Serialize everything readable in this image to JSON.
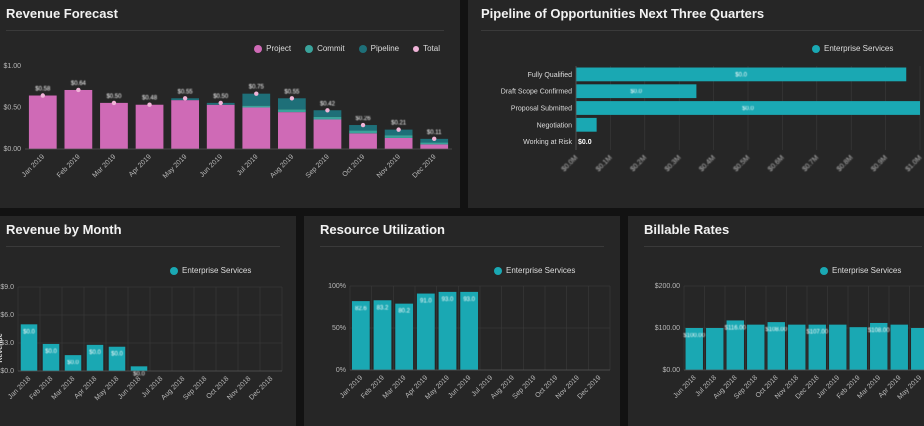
{
  "colors": {
    "project": "#cf6ab6",
    "commit": "#3aa39b",
    "pipeline": "#1e6f78",
    "total": "#f0b4d8",
    "enterprise": "#1aa8b3",
    "grid": "#3c3c3c",
    "text": "#b8b8b8"
  },
  "panels": {
    "revenue_forecast": {
      "title": "Revenue Forecast",
      "legend": [
        "Project",
        "Commit",
        "Pipeline",
        "Total"
      ]
    },
    "pipeline": {
      "title": "Pipeline of Opportunities Next Three Quarters",
      "legend": [
        "Enterprise Services"
      ]
    },
    "revenue_by_month": {
      "title": "Revenue by Month",
      "legend": [
        "Enterprise Services"
      ],
      "ylabel": "Revenue"
    },
    "resource_utilization": {
      "title": "Resource Utilization",
      "legend": [
        "Enterprise Services"
      ]
    },
    "billable_rates": {
      "title": "Billable Rates",
      "legend": [
        "Enterprise Services"
      ]
    }
  },
  "chart_data": [
    {
      "id": "revenue_forecast",
      "type": "bar",
      "stacked": true,
      "categories": [
        "Jan 2019",
        "Feb 2019",
        "Mar 2019",
        "Apr 2019",
        "May 2019",
        "Jun 2019",
        "Jul 2019",
        "Aug 2019",
        "Sep 2019",
        "Oct 2019",
        "Nov 2019",
        "Dec 2019"
      ],
      "series": [
        {
          "name": "Project",
          "values": [
            0.58,
            0.64,
            0.5,
            0.48,
            0.53,
            0.48,
            0.45,
            0.4,
            0.32,
            0.17,
            0.12,
            0.05
          ]
        },
        {
          "name": "Commit",
          "values": [
            0,
            0,
            0,
            0,
            0,
            0,
            0.02,
            0.03,
            0.03,
            0.03,
            0.03,
            0.02
          ]
        },
        {
          "name": "Pipeline",
          "values": [
            0,
            0,
            0,
            0,
            0.02,
            0.02,
            0.13,
            0.12,
            0.07,
            0.06,
            0.06,
            0.04
          ]
        }
      ],
      "total_labels": [
        "$0.58",
        "$0.64",
        "$0.50",
        "$0.48",
        "$0.55",
        "$0.50",
        "$0.75",
        "$0.55",
        "$0.42",
        "$0.26",
        "$0.21",
        "$0.11"
      ],
      "yticks": [
        "$1.00",
        "$0.50",
        "$0.00"
      ],
      "ylim": [
        0,
        0.9
      ]
    },
    {
      "id": "pipeline",
      "type": "bar",
      "orientation": "horizontal",
      "categories": [
        "Fully Qualified",
        "Draft Scope Confirmed",
        "Proposal Submitted",
        "Negotiation",
        "Working at Risk"
      ],
      "series": [
        {
          "name": "Enterprise Services",
          "values": [
            0.96,
            0.35,
            1.0,
            0.06,
            0.0
          ]
        }
      ],
      "bar_labels": [
        "$0.0",
        "$0.0",
        "$0.0",
        "",
        ""
      ],
      "end_label": "$0.0",
      "xticks": [
        "$0.0M",
        "$0.1M",
        "$0.2M",
        "$0.3M",
        "$0.4M",
        "$0.5M",
        "$0.6M",
        "$0.7M",
        "$0.8M",
        "$0.9M",
        "$1.0M"
      ],
      "xlim": [
        0,
        1.0
      ]
    },
    {
      "id": "revenue_by_month",
      "type": "bar",
      "categories": [
        "Jan 2018",
        "Feb 2018",
        "Mar 2018",
        "Apr 2018",
        "May 2018",
        "Jun 2018",
        "Jul 2018",
        "Aug 2018",
        "Sep 2018",
        "Oct 2018",
        "Nov 2018",
        "Dec 2018"
      ],
      "series": [
        {
          "name": "Enterprise Services",
          "values": [
            5.0,
            2.9,
            1.7,
            2.8,
            2.6,
            0.5,
            0,
            0,
            0,
            0,
            0,
            0
          ]
        }
      ],
      "bar_labels": [
        "$0.0",
        "$0.0",
        "$0.0",
        "$0.0",
        "$0.0",
        "$0.0",
        "",
        "",
        "",
        "",
        "",
        ""
      ],
      "yticks": [
        "$9.0",
        "$6.0",
        "$3.0",
        "$0.0"
      ],
      "ylim": [
        0,
        9
      ]
    },
    {
      "id": "resource_utilization",
      "type": "bar",
      "categories": [
        "Jan 2019",
        "Feb 2019",
        "Mar 2019",
        "Apr 2019",
        "May 2019",
        "Jun 2019",
        "Jul 2019",
        "Aug 2019",
        "Sep 2019",
        "Oct 2019",
        "Nov 2019",
        "Dec 2019"
      ],
      "series": [
        {
          "name": "Enterprise Services",
          "values": [
            82,
            83,
            79,
            91,
            93,
            93,
            0,
            0,
            0,
            0,
            0,
            0
          ]
        }
      ],
      "bar_labels": [
        "82.6",
        "83.2",
        "80.2",
        "91.0",
        "93.0",
        "93.0",
        "",
        "",
        "",
        "",
        "",
        ""
      ],
      "yticks": [
        "100%",
        "50%",
        "0%"
      ],
      "ylim": [
        0,
        100
      ]
    },
    {
      "id": "billable_rates",
      "type": "bar",
      "categories": [
        "Jun 2018",
        "Jul 2018",
        "Aug 2018",
        "Sep 2018",
        "Oct 2018",
        "Nov 2018",
        "Dec 2018",
        "Jan 2019",
        "Feb 2019",
        "Mar 2019",
        "Apr 2019",
        "May 2019"
      ],
      "series": [
        {
          "name": "Enterprise Services",
          "values": [
            100,
            100,
            118,
            108,
            114,
            108,
            108,
            108,
            102,
            112,
            108,
            100
          ]
        }
      ],
      "bar_labels": [
        "$100.00",
        "",
        "$116.00",
        "",
        "$108.00",
        "",
        "$107.00",
        "",
        "",
        "$108.00",
        "",
        ""
      ],
      "yticks": [
        "$200.00",
        "$100.00",
        "$0.00"
      ],
      "ylim": [
        0,
        200
      ]
    }
  ]
}
